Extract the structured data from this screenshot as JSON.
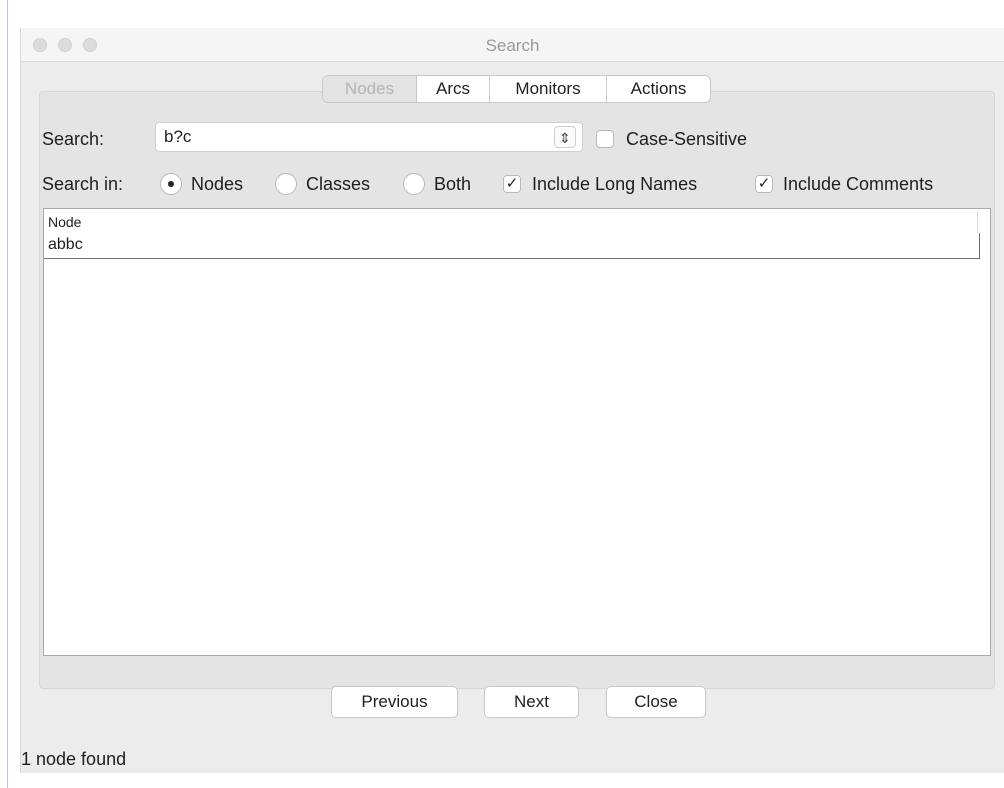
{
  "window": {
    "title": "Search",
    "traffic_lights": [
      "close",
      "minimize",
      "zoom"
    ]
  },
  "tabs": [
    {
      "label": "Nodes",
      "selected": true
    },
    {
      "label": "Arcs",
      "selected": false
    },
    {
      "label": "Monitors",
      "selected": false
    },
    {
      "label": "Actions",
      "selected": false
    }
  ],
  "search": {
    "label": "Search:",
    "value": "b?c",
    "stepper_icon": "updown-chevron-icon",
    "case_sensitive": {
      "label": "Case-Sensitive",
      "checked": false
    }
  },
  "search_in": {
    "label": "Search in:",
    "options": [
      {
        "label": "Nodes",
        "selected": true
      },
      {
        "label": "Classes",
        "selected": false
      },
      {
        "label": "Both",
        "selected": false
      }
    ],
    "include_long_names": {
      "label": "Include Long Names",
      "checked": true
    },
    "include_comments": {
      "label": "Include Comments",
      "checked": true
    }
  },
  "results": {
    "column_header": "Node",
    "rows": [
      "abbc"
    ]
  },
  "buttons": {
    "previous": "Previous",
    "next": "Next",
    "close": "Close"
  },
  "status": "1 node found",
  "colors": {
    "window_bg": "#ececec",
    "panel_bg": "#e4e4e4",
    "title_text": "#9a9a9a"
  }
}
